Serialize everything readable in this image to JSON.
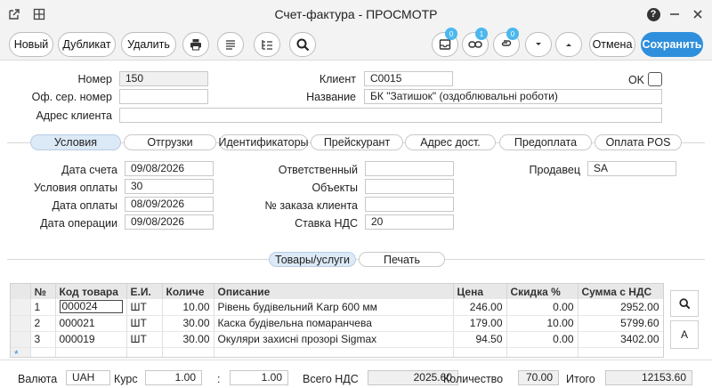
{
  "window": {
    "title": "Счет-фактура - ПРОСМОТР",
    "help_icon": "?"
  },
  "toolbar": {
    "new_label": "Новый",
    "duplicate_label": "Дубликат",
    "delete_label": "Удалить",
    "inbox_badge": "0",
    "link_badge": "1",
    "attach_badge": "0",
    "cancel_label": "Отмена",
    "save_label": "Сохранить",
    "accent_color": "#2f8fdc"
  },
  "header": {
    "number_label": "Номер",
    "number_value": "150",
    "serial_label": "Оф. сер. номер",
    "serial_value": "",
    "address_label": "Адрес клиента",
    "address_value": "",
    "client_label": "Клиент",
    "client_value": "C0015",
    "name_label": "Название",
    "name_value": "БК \"Затишок\" (оздоблювальні роботи)",
    "ok_label": "OK"
  },
  "tabs": [
    "Условия",
    "Отгрузки",
    "Идентификаторы",
    "Прейскурант",
    "Адрес дост.",
    "Предоплата",
    "Оплата POS"
  ],
  "conditions": {
    "invoice_date_label": "Дата счета",
    "invoice_date_value": "09/08/2026",
    "payment_terms_label": "Условия оплаты",
    "payment_terms_value": "30",
    "payment_date_label": "Дата оплаты",
    "payment_date_value": "08/09/2026",
    "operation_date_label": "Дата операции",
    "operation_date_value": "09/08/2026",
    "responsible_label": "Ответственный",
    "responsible_value": "",
    "objects_label": "Объекты",
    "objects_value": "",
    "order_no_label": "№ заказа клиента",
    "order_no_value": "",
    "vat_rate_label": "Ставка НДС",
    "vat_rate_value": "20",
    "seller_label": "Продавец",
    "seller_value": "SA"
  },
  "subtabs": [
    "Товары/услуги",
    "Печать"
  ],
  "grid": {
    "columns": [
      "№",
      "Код товара",
      "Е.И.",
      "Количе",
      "Описание",
      "Цена",
      "Скидка %",
      "Сумма с НДС"
    ],
    "rows": [
      {
        "n": "1",
        "code": "000024",
        "unit": "ШТ",
        "qty": "10.00",
        "desc": "Рівень будівельний Karp 600 мм",
        "price": "246.00",
        "discount": "0.00",
        "total": "2952.00"
      },
      {
        "n": "2",
        "code": "000021",
        "unit": "ШТ",
        "qty": "30.00",
        "desc": "Каска будівельна помаранчева",
        "price": "179.00",
        "discount": "10.00",
        "total": "5799.60"
      },
      {
        "n": "3",
        "code": "000019",
        "unit": "ШТ",
        "qty": "30.00",
        "desc": "Окуляри захисні прозорі Sigmax",
        "price": "94.50",
        "discount": "0.00",
        "total": "3402.00"
      }
    ],
    "new_row_marker": "*",
    "side_a_label": "A"
  },
  "footer": {
    "currency_label": "Валюта",
    "currency_value": "UAH",
    "rate_label": "Курс",
    "rate_value": "1.00",
    "rate_sep": ":",
    "rate_value2": "1.00",
    "vat_total_label": "Всего НДС",
    "vat_total_value": "2025.60",
    "quantity_label": "Количество",
    "quantity_value": "70.00",
    "total_label": "Итого",
    "total_value": "12153.60"
  }
}
